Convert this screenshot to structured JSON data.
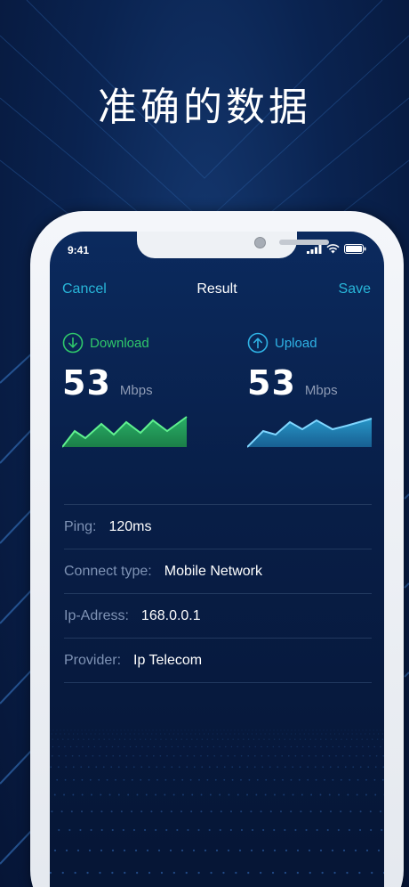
{
  "headline": "准确的数据",
  "status": {
    "time": "9:41"
  },
  "nav": {
    "cancel": "Cancel",
    "title": "Result",
    "save": "Save"
  },
  "download": {
    "label": "Download",
    "value": "53",
    "unit": "Mbps"
  },
  "upload": {
    "label": "Upload",
    "value": "53",
    "unit": "Mbps"
  },
  "info": [
    {
      "key": "Ping:",
      "value": "120ms"
    },
    {
      "key": "Connect type:",
      "value": "Mobile Network"
    },
    {
      "key": "Ip-Adress:",
      "value": "168.0.0.1"
    },
    {
      "key": "Provider:",
      "value": "Ip Telecom"
    }
  ],
  "colors": {
    "accent": "#28b6d9",
    "download": "#2fc86b",
    "upload": "#2fb3e6"
  }
}
